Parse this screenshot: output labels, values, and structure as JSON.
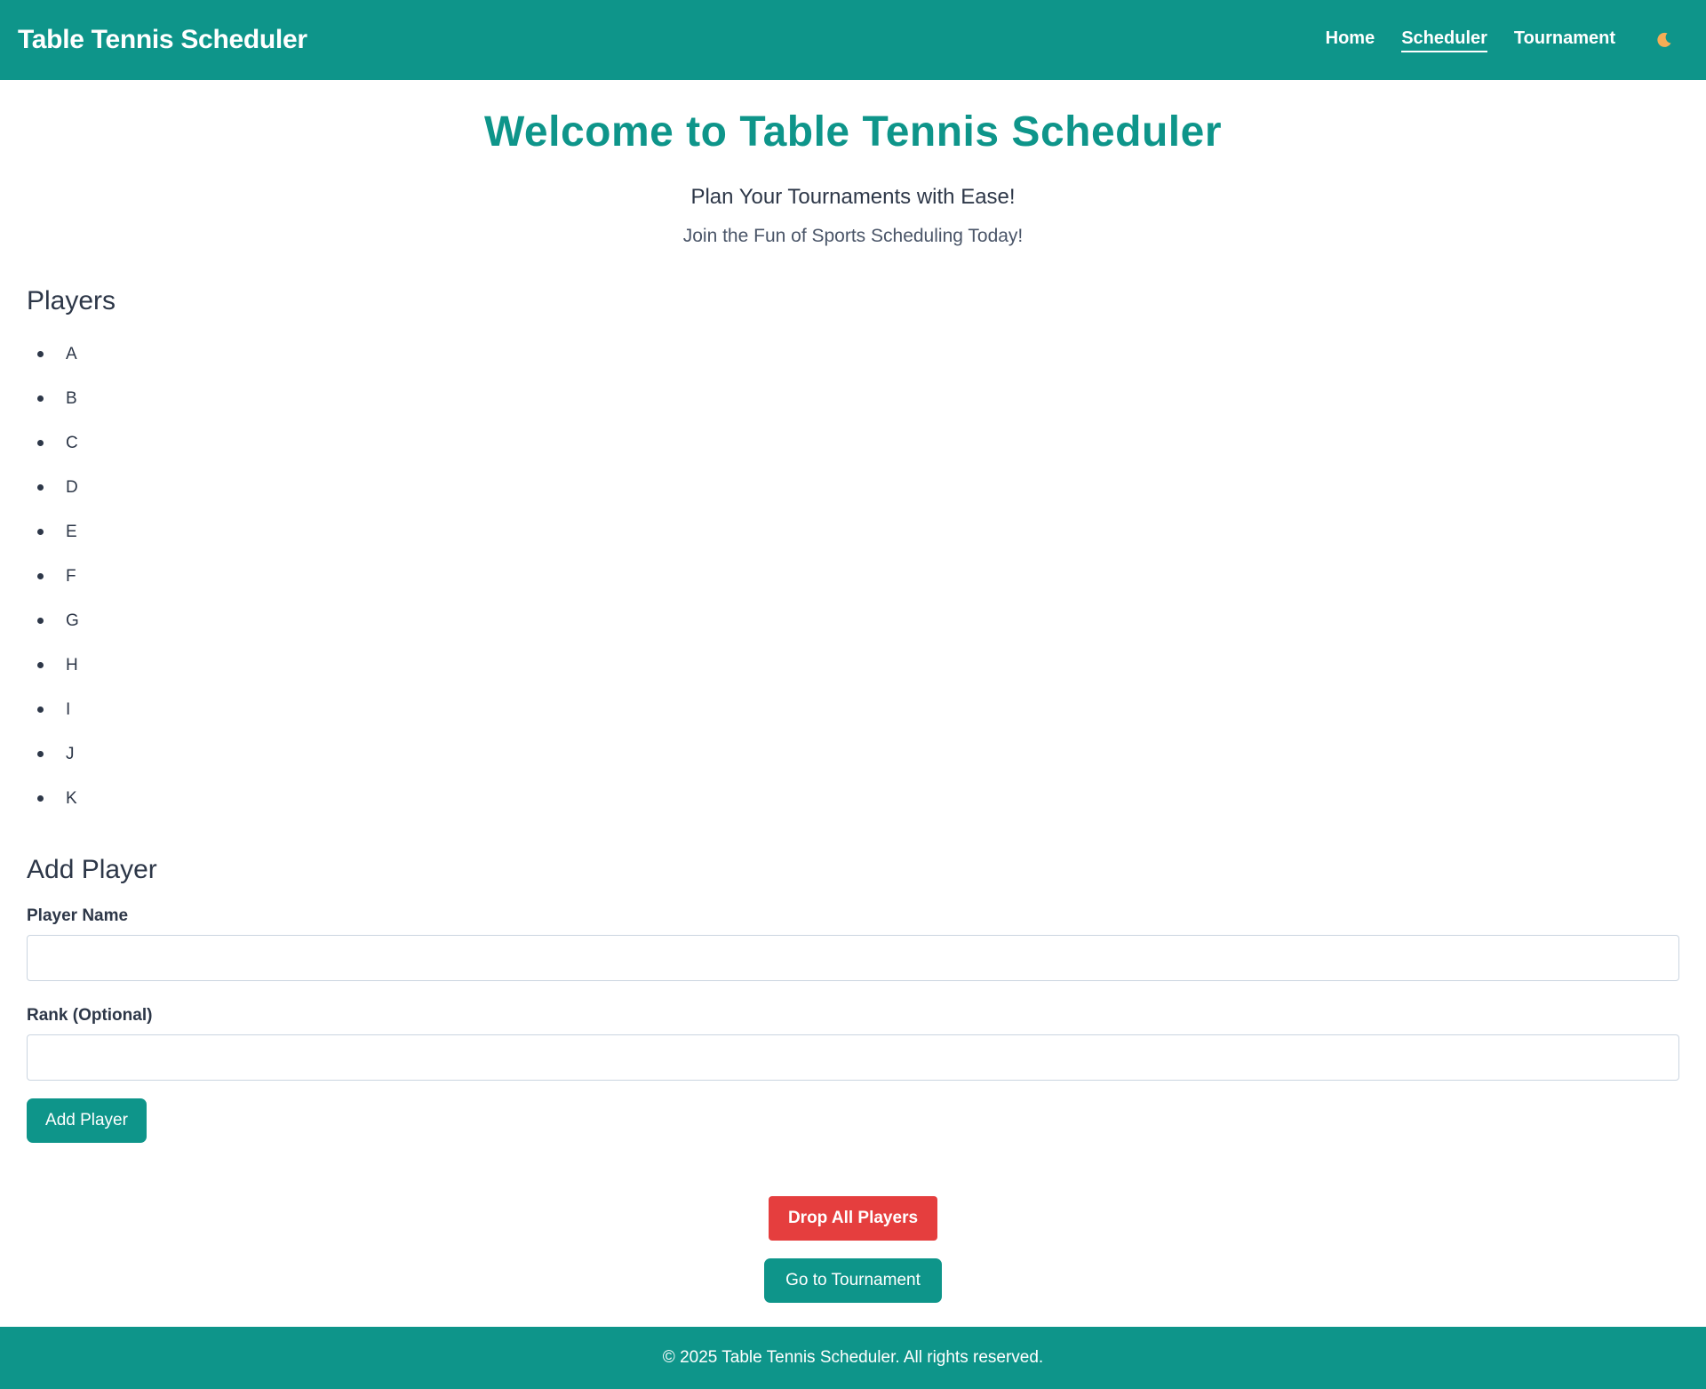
{
  "header": {
    "brand": "Table Tennis Scheduler",
    "nav": [
      {
        "label": "Home",
        "active": false
      },
      {
        "label": "Scheduler",
        "active": true
      },
      {
        "label": "Tournament",
        "active": false
      }
    ],
    "theme_toggle_icon": "moon-icon"
  },
  "hero": {
    "title": "Welcome to Table Tennis Scheduler",
    "tagline": "Plan Your Tournaments with Ease!",
    "subtagline": "Join the Fun of Sports Scheduling Today!"
  },
  "players": {
    "title": "Players",
    "items": [
      "A",
      "B",
      "C",
      "D",
      "E",
      "F",
      "G",
      "H",
      "I",
      "J",
      "K"
    ]
  },
  "add_player": {
    "title": "Add Player",
    "name_label": "Player Name",
    "name_value": "",
    "rank_label": "Rank (Optional)",
    "rank_value": "",
    "submit_label": "Add Player"
  },
  "actions": {
    "drop_all_label": "Drop All Players",
    "go_tournament_label": "Go to Tournament"
  },
  "footer": {
    "text": "© 2025 Table Tennis Scheduler. All rights reserved."
  },
  "colors": {
    "brand": "#0e958a",
    "danger": "#e53e3e",
    "text": "#2d3748",
    "moon": "#f6ad55"
  }
}
